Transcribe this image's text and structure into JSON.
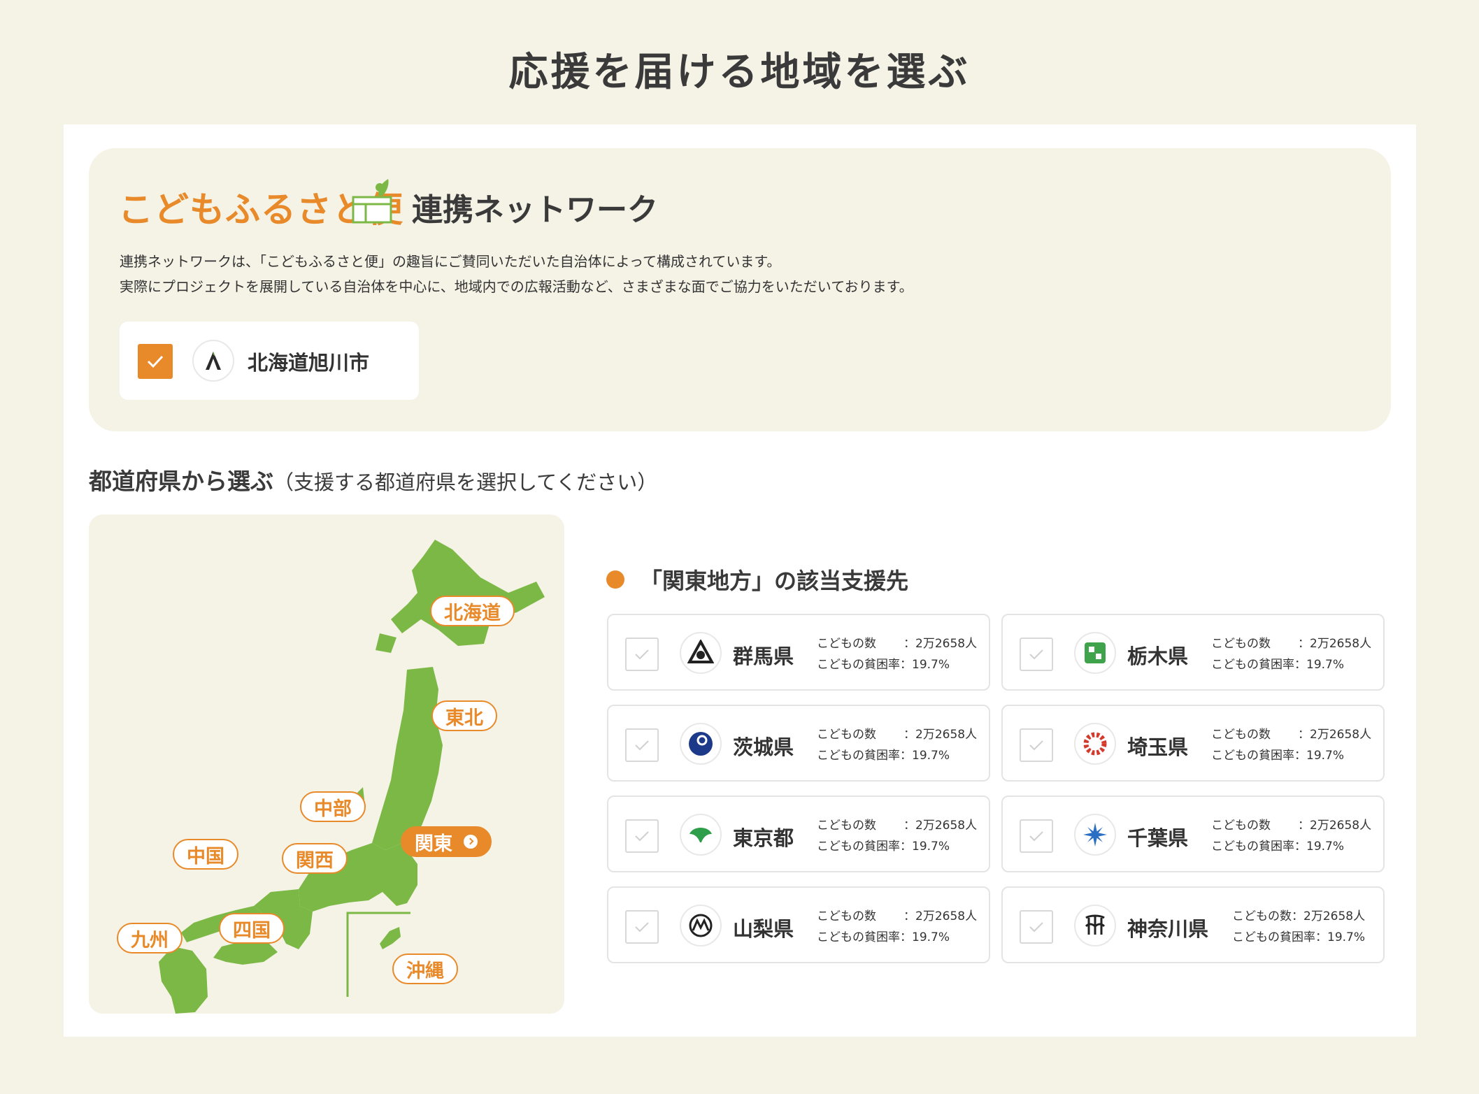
{
  "page_title": "応援を届ける地域を選ぶ",
  "network": {
    "brand": "こどもふるさと便",
    "heading": "連携ネットワーク",
    "desc_line1": "連携ネットワークは、「こどもふるさと便」の趣旨にご賛同いただいた自治体によって構成されています。",
    "desc_line2": "実際にプロジェクトを展開している自治体を中心に、地域内での広報活動など、さまざまな面でご協力をいただいております。",
    "municipality": {
      "name": "北海道旭川市",
      "checked": true,
      "emblem_icon": "asahikawa-emblem-icon"
    }
  },
  "prefecture_section": {
    "heading": "都道府県から選ぶ",
    "subheading": "（支援する都道府県を選択してください）"
  },
  "map": {
    "regions": [
      {
        "id": "hokkaido",
        "label": "北海道",
        "active": false
      },
      {
        "id": "tohoku",
        "label": "東北",
        "active": false
      },
      {
        "id": "chubu",
        "label": "中部",
        "active": false
      },
      {
        "id": "kanto",
        "label": "関東",
        "active": true
      },
      {
        "id": "chugoku",
        "label": "中国",
        "active": false
      },
      {
        "id": "kansai",
        "label": "関西",
        "active": false
      },
      {
        "id": "shikoku",
        "label": "四国",
        "active": false
      },
      {
        "id": "kyushu",
        "label": "九州",
        "active": false
      },
      {
        "id": "okinawa",
        "label": "沖縄",
        "active": false
      }
    ],
    "land_color": "#7cb845",
    "accent_color": "#e88a2a"
  },
  "results": {
    "heading": "「関東地方」の該当支援先",
    "prefectures": [
      {
        "name": "群馬県",
        "children_label": "こどもの数",
        "children_value": "：2万2658人",
        "poverty_label": "こどもの貧困率",
        "poverty_value": "：19.7%",
        "emblem_icon": "gunma-emblem-icon"
      },
      {
        "name": "栃木県",
        "children_label": "こどもの数",
        "children_value": "：2万2658人",
        "poverty_label": "こどもの貧困率",
        "poverty_value": "：19.7%",
        "emblem_icon": "tochigi-emblem-icon"
      },
      {
        "name": "茨城県",
        "children_label": "こどもの数",
        "children_value": "：2万2658人",
        "poverty_label": "こどもの貧困率",
        "poverty_value": "：19.7%",
        "emblem_icon": "ibaraki-emblem-icon"
      },
      {
        "name": "埼玉県",
        "children_label": "こどもの数",
        "children_value": "：2万2658人",
        "poverty_label": "こどもの貧困率",
        "poverty_value": "：19.7%",
        "emblem_icon": "saitama-emblem-icon"
      },
      {
        "name": "東京都",
        "children_label": "こどもの数",
        "children_value": "：2万2658人",
        "poverty_label": "こどもの貧困率",
        "poverty_value": "：19.7%",
        "emblem_icon": "tokyo-emblem-icon"
      },
      {
        "name": "千葉県",
        "children_label": "こどもの数",
        "children_value": "：2万2658人",
        "poverty_label": "こどもの貧困率",
        "poverty_value": "：19.7%",
        "emblem_icon": "chiba-emblem-icon"
      },
      {
        "name": "山梨県",
        "children_label": "こどもの数",
        "children_value": "：2万2658人",
        "poverty_label": "こどもの貧困率",
        "poverty_value": "：19.7%",
        "emblem_icon": "yamanashi-emblem-icon"
      },
      {
        "name": "神奈川県",
        "children_label": "こどもの数",
        "children_value": "：2万2658人",
        "poverty_label": "こどもの貧困率",
        "poverty_value": "：19.7%",
        "emblem_icon": "kanagawa-emblem-icon"
      }
    ]
  }
}
